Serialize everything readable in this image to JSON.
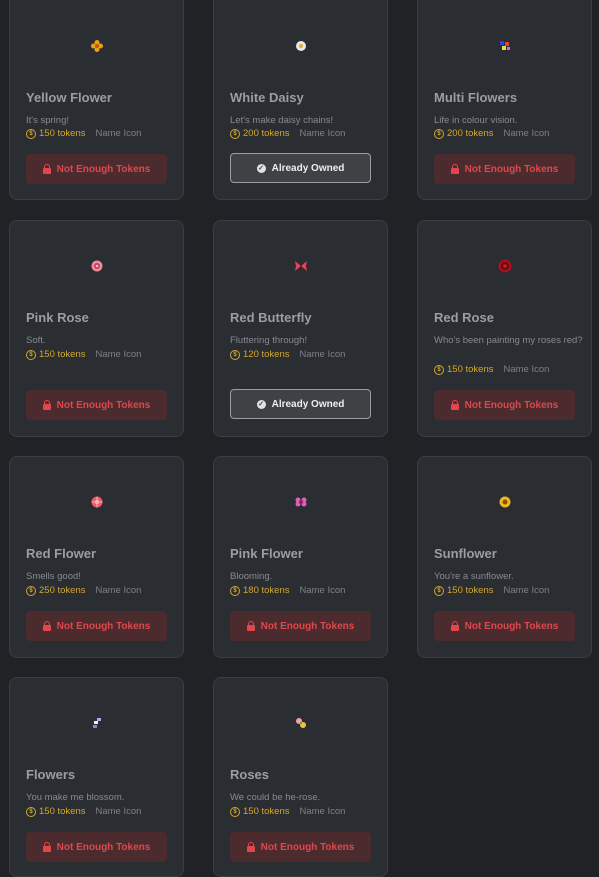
{
  "items": [
    {
      "title": "Yellow Flower",
      "desc": "It's spring!",
      "tokens": "150 tokens",
      "tag": "Name Icon",
      "button": "Not Enough Tokens",
      "owned": false,
      "icon": "yellow-flower",
      "icon_color": "#e8a21a"
    },
    {
      "title": "White Daisy",
      "desc": "Let's make daisy chains!",
      "tokens": "200 tokens",
      "tag": "Name Icon",
      "button": "Already Owned",
      "owned": true,
      "icon": "white-daisy",
      "icon_color": "#e8e8e8"
    },
    {
      "title": "Multi Flowers",
      "desc": "Life in colour vision.",
      "tokens": "200 tokens",
      "tag": "Name Icon",
      "button": "Not Enough Tokens",
      "owned": false,
      "icon": "multi-flowers",
      "icon_color": "#6a6ae8"
    },
    {
      "title": "Pink Rose",
      "desc": "Soft.",
      "tokens": "150 tokens",
      "tag": "Name Icon",
      "button": "Not Enough Tokens",
      "owned": false,
      "icon": "pink-rose",
      "icon_color": "#f08aa0"
    },
    {
      "title": "Red Butterfly",
      "desc": "Fluttering through!",
      "tokens": "120 tokens",
      "tag": "Name Icon",
      "button": "Already Owned",
      "owned": true,
      "icon": "red-butterfly",
      "icon_color": "#e8405a"
    },
    {
      "title": "Red Rose",
      "desc": "Who's been painting my roses red?",
      "tokens": "150 tokens",
      "tag": "Name Icon",
      "button": "Not Enough Tokens",
      "owned": false,
      "icon": "red-rose",
      "icon_color": "#a8101a"
    },
    {
      "title": "Red Flower",
      "desc": "Smells good!",
      "tokens": "250 tokens",
      "tag": "Name Icon",
      "button": "Not Enough Tokens",
      "owned": false,
      "icon": "red-flower",
      "icon_color": "#ee5a6a"
    },
    {
      "title": "Pink Flower",
      "desc": "Blooming.",
      "tokens": "180 tokens",
      "tag": "Name Icon",
      "button": "Not Enough Tokens",
      "owned": false,
      "icon": "pink-flower",
      "icon_color": "#e060b8"
    },
    {
      "title": "Sunflower",
      "desc": "You're a sunflower.",
      "tokens": "150 tokens",
      "tag": "Name Icon",
      "button": "Not Enough Tokens",
      "owned": false,
      "icon": "sunflower",
      "icon_color": "#f0b820"
    },
    {
      "title": "Flowers",
      "desc": "You make me blossom.",
      "tokens": "150 tokens",
      "tag": "Name Icon",
      "button": "Not Enough Tokens",
      "owned": false,
      "icon": "flowers",
      "icon_color": "#b0a8f0"
    },
    {
      "title": "Roses",
      "desc": "We could be he-rose.",
      "tokens": "150 tokens",
      "tag": "Name Icon",
      "button": "Not Enough Tokens",
      "owned": false,
      "icon": "roses",
      "icon_color": "#f4a0a8"
    }
  ]
}
